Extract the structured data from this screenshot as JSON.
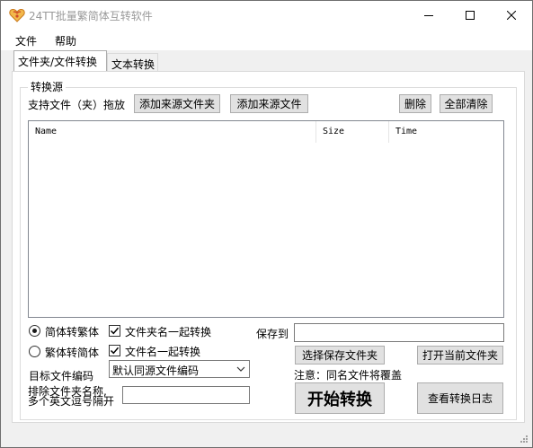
{
  "window": {
    "title": "24TT批量繁简体互转软件",
    "icon": "heart-icon",
    "accent_color": "#e8a317"
  },
  "menu": {
    "items": [
      "文件",
      "帮助"
    ]
  },
  "tabs": [
    {
      "label": "文件夹/文件转换",
      "active": true
    },
    {
      "label": "文本转换",
      "active": false
    }
  ],
  "source_group": {
    "title": "转换源",
    "drag_hint": "支持文件（夹）拖放",
    "add_folder_button": "添加来源文件夹",
    "add_file_button": "添加来源文件",
    "delete_button": "删除",
    "clear_all_button": "全部清除"
  },
  "file_list": {
    "columns": [
      "Name",
      "Size",
      "Time"
    ],
    "rows": []
  },
  "options": {
    "radio_s2t": {
      "label": "简体转繁体",
      "checked": true
    },
    "radio_t2s": {
      "label": "繁体转简体",
      "checked": false
    },
    "check_folder_name": {
      "label": "文件夹名一起转换",
      "checked": true
    },
    "check_file_name": {
      "label": "文件名一起转换",
      "checked": true
    },
    "target_encoding_label": "目标文件编码",
    "target_encoding_value": "默认同源文件编码",
    "exclude_label_line1": "排除文件夹名称,",
    "exclude_label_line2": "多个英文逗号隔开",
    "exclude_value": ""
  },
  "output": {
    "save_to_label": "保存到",
    "save_to_value": "",
    "choose_folder_button": "选择保存文件夹",
    "open_folder_button": "打开当前文件夹",
    "notice": "注意：同名文件将覆盖",
    "start_button": "开始转换",
    "view_log_button": "查看转换日志"
  }
}
